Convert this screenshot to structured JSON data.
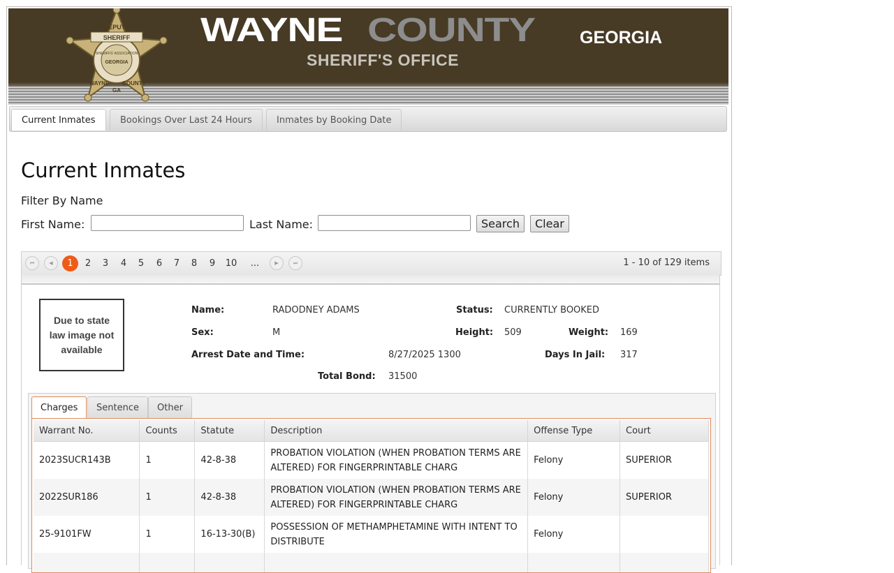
{
  "header": {
    "title_part1": "WAYNE",
    "title_part2": "COUNTY",
    "state": "GEORGIA",
    "subtitle": "SHERIFF'S OFFICE",
    "badge": {
      "top": "DEPUTY",
      "ribbon": "SHERIFF",
      "ring": "SHERIFFS' ASSOCIATION",
      "bottom_left": "WAYNE",
      "bottom_mid": "GA",
      "bottom_right": "COUNTY",
      "center": "GEORGIA"
    }
  },
  "nav_tabs": [
    {
      "label": "Current Inmates",
      "active": true
    },
    {
      "label": "Bookings Over Last 24 Hours",
      "active": false
    },
    {
      "label": "Inmates by Booking Date",
      "active": false
    }
  ],
  "page_title": "Current Inmates",
  "filter": {
    "heading": "Filter By Name",
    "first_label": "First Name:",
    "last_label": "Last Name:",
    "first_value": "",
    "last_value": "",
    "search_label": "Search",
    "clear_label": "Clear"
  },
  "pager": {
    "pages": [
      "1",
      "2",
      "3",
      "4",
      "5",
      "6",
      "7",
      "8",
      "9",
      "10",
      "..."
    ],
    "current": "1",
    "info": "1 - 10 of 129 items"
  },
  "inmate": {
    "photo_text": "Due to state law image not available",
    "name_label": "Name:",
    "name": "RADODNEY ADAMS",
    "status_label": "Status:",
    "status": "CURRENTLY BOOKED",
    "sex_label": "Sex:",
    "sex": "M",
    "height_label": "Height:",
    "height": "509",
    "weight_label": "Weight:",
    "weight": "169",
    "arrest_label": "Arrest Date and Time:",
    "arrest": "8/27/2025 1300",
    "days_label": "Days In Jail:",
    "days": "317",
    "bond_label": "Total Bond:",
    "bond": "31500"
  },
  "detail_tabs": [
    {
      "label": "Charges",
      "active": true
    },
    {
      "label": "Sentence",
      "active": false
    },
    {
      "label": "Other",
      "active": false
    }
  ],
  "charges": {
    "columns": [
      "Warrant No.",
      "Counts",
      "Statute",
      "Description",
      "Offense Type",
      "Court"
    ],
    "rows": [
      [
        "2023SUCR143B",
        "1",
        "42-8-38",
        "PROBATION VIOLATION (WHEN PROBATION TERMS ARE ALTERED) FOR FINGERPRINTABLE CHARG",
        "Felony",
        "SUPERIOR"
      ],
      [
        "2022SUR186",
        "1",
        "42-8-38",
        "PROBATION VIOLATION (WHEN PROBATION TERMS ARE ALTERED) FOR FINGERPRINTABLE CHARG",
        "Felony",
        "SUPERIOR"
      ],
      [
        "25-9101FW",
        "1",
        "16-13-30(B)",
        "POSSESSION OF METHAMPHETAMINE WITH INTENT TO DISTRIBUTE",
        "Felony",
        ""
      ]
    ]
  }
}
